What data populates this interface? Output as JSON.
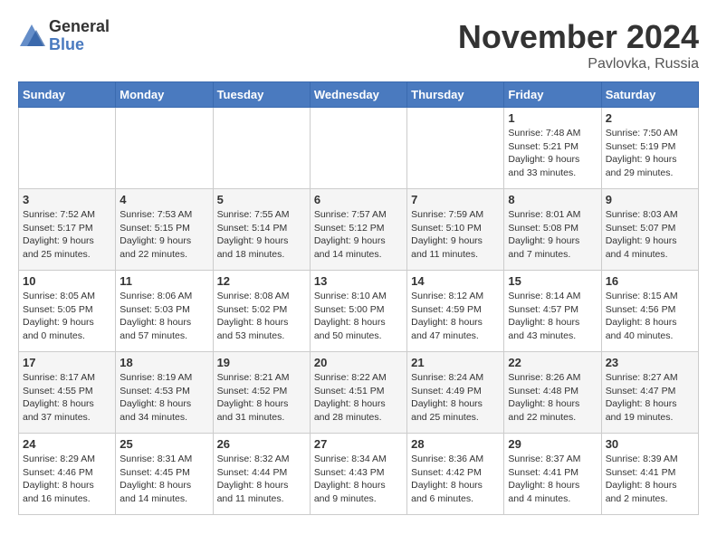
{
  "logo": {
    "general": "General",
    "blue": "Blue"
  },
  "header": {
    "month": "November 2024",
    "location": "Pavlovka, Russia"
  },
  "weekdays": [
    "Sunday",
    "Monday",
    "Tuesday",
    "Wednesday",
    "Thursday",
    "Friday",
    "Saturday"
  ],
  "weeks": [
    [
      {
        "day": "",
        "info": ""
      },
      {
        "day": "",
        "info": ""
      },
      {
        "day": "",
        "info": ""
      },
      {
        "day": "",
        "info": ""
      },
      {
        "day": "",
        "info": ""
      },
      {
        "day": "1",
        "info": "Sunrise: 7:48 AM\nSunset: 5:21 PM\nDaylight: 9 hours\nand 33 minutes."
      },
      {
        "day": "2",
        "info": "Sunrise: 7:50 AM\nSunset: 5:19 PM\nDaylight: 9 hours\nand 29 minutes."
      }
    ],
    [
      {
        "day": "3",
        "info": "Sunrise: 7:52 AM\nSunset: 5:17 PM\nDaylight: 9 hours\nand 25 minutes."
      },
      {
        "day": "4",
        "info": "Sunrise: 7:53 AM\nSunset: 5:15 PM\nDaylight: 9 hours\nand 22 minutes."
      },
      {
        "day": "5",
        "info": "Sunrise: 7:55 AM\nSunset: 5:14 PM\nDaylight: 9 hours\nand 18 minutes."
      },
      {
        "day": "6",
        "info": "Sunrise: 7:57 AM\nSunset: 5:12 PM\nDaylight: 9 hours\nand 14 minutes."
      },
      {
        "day": "7",
        "info": "Sunrise: 7:59 AM\nSunset: 5:10 PM\nDaylight: 9 hours\nand 11 minutes."
      },
      {
        "day": "8",
        "info": "Sunrise: 8:01 AM\nSunset: 5:08 PM\nDaylight: 9 hours\nand 7 minutes."
      },
      {
        "day": "9",
        "info": "Sunrise: 8:03 AM\nSunset: 5:07 PM\nDaylight: 9 hours\nand 4 minutes."
      }
    ],
    [
      {
        "day": "10",
        "info": "Sunrise: 8:05 AM\nSunset: 5:05 PM\nDaylight: 9 hours\nand 0 minutes."
      },
      {
        "day": "11",
        "info": "Sunrise: 8:06 AM\nSunset: 5:03 PM\nDaylight: 8 hours\nand 57 minutes."
      },
      {
        "day": "12",
        "info": "Sunrise: 8:08 AM\nSunset: 5:02 PM\nDaylight: 8 hours\nand 53 minutes."
      },
      {
        "day": "13",
        "info": "Sunrise: 8:10 AM\nSunset: 5:00 PM\nDaylight: 8 hours\nand 50 minutes."
      },
      {
        "day": "14",
        "info": "Sunrise: 8:12 AM\nSunset: 4:59 PM\nDaylight: 8 hours\nand 47 minutes."
      },
      {
        "day": "15",
        "info": "Sunrise: 8:14 AM\nSunset: 4:57 PM\nDaylight: 8 hours\nand 43 minutes."
      },
      {
        "day": "16",
        "info": "Sunrise: 8:15 AM\nSunset: 4:56 PM\nDaylight: 8 hours\nand 40 minutes."
      }
    ],
    [
      {
        "day": "17",
        "info": "Sunrise: 8:17 AM\nSunset: 4:55 PM\nDaylight: 8 hours\nand 37 minutes."
      },
      {
        "day": "18",
        "info": "Sunrise: 8:19 AM\nSunset: 4:53 PM\nDaylight: 8 hours\nand 34 minutes."
      },
      {
        "day": "19",
        "info": "Sunrise: 8:21 AM\nSunset: 4:52 PM\nDaylight: 8 hours\nand 31 minutes."
      },
      {
        "day": "20",
        "info": "Sunrise: 8:22 AM\nSunset: 4:51 PM\nDaylight: 8 hours\nand 28 minutes."
      },
      {
        "day": "21",
        "info": "Sunrise: 8:24 AM\nSunset: 4:49 PM\nDaylight: 8 hours\nand 25 minutes."
      },
      {
        "day": "22",
        "info": "Sunrise: 8:26 AM\nSunset: 4:48 PM\nDaylight: 8 hours\nand 22 minutes."
      },
      {
        "day": "23",
        "info": "Sunrise: 8:27 AM\nSunset: 4:47 PM\nDaylight: 8 hours\nand 19 minutes."
      }
    ],
    [
      {
        "day": "24",
        "info": "Sunrise: 8:29 AM\nSunset: 4:46 PM\nDaylight: 8 hours\nand 16 minutes."
      },
      {
        "day": "25",
        "info": "Sunrise: 8:31 AM\nSunset: 4:45 PM\nDaylight: 8 hours\nand 14 minutes."
      },
      {
        "day": "26",
        "info": "Sunrise: 8:32 AM\nSunset: 4:44 PM\nDaylight: 8 hours\nand 11 minutes."
      },
      {
        "day": "27",
        "info": "Sunrise: 8:34 AM\nSunset: 4:43 PM\nDaylight: 8 hours\nand 9 minutes."
      },
      {
        "day": "28",
        "info": "Sunrise: 8:36 AM\nSunset: 4:42 PM\nDaylight: 8 hours\nand 6 minutes."
      },
      {
        "day": "29",
        "info": "Sunrise: 8:37 AM\nSunset: 4:41 PM\nDaylight: 8 hours\nand 4 minutes."
      },
      {
        "day": "30",
        "info": "Sunrise: 8:39 AM\nSunset: 4:41 PM\nDaylight: 8 hours\nand 2 minutes."
      }
    ]
  ]
}
